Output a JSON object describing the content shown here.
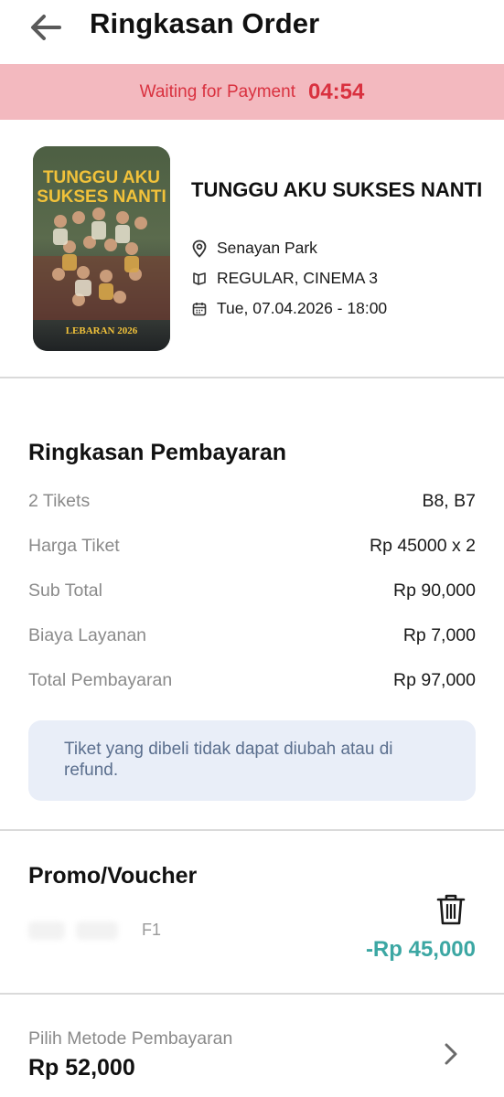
{
  "header": {
    "title": "Ringkasan Order"
  },
  "timer": {
    "label": "Waiting for Payment",
    "value": "04:54"
  },
  "movie": {
    "title": "TUNGGU AKU SUKSES NANTI",
    "poster_title_lines": [
      "TUNGGU AKU",
      "SUKSES NANTI"
    ],
    "poster_footer": "LEBARAN 2026",
    "venue": "Senayan Park",
    "studio": "REGULAR, CINEMA 3",
    "datetime": "Tue, 07.04.2026 - 18:00"
  },
  "payment_summary": {
    "title": "Ringkasan Pembayaran",
    "rows": [
      {
        "label": "2 Tikets",
        "value": "B8, B7"
      },
      {
        "label": "Harga Tiket",
        "value": "Rp 45000 x 2"
      },
      {
        "label": "Sub Total",
        "value": "Rp 90,000"
      },
      {
        "label": "Biaya Layanan",
        "value": "Rp 7,000"
      },
      {
        "label": "Total Pembayaran",
        "value": "Rp 97,000"
      }
    ],
    "notice": "Tiket yang dibeli tidak dapat diubah atau di refund."
  },
  "promo": {
    "title": "Promo/Voucher",
    "code_visible_tail": "F1",
    "discount": "-Rp 45,000"
  },
  "payment_method": {
    "label": "Pilih Metode Pembayaran",
    "total": "Rp 52,000"
  },
  "colors": {
    "timer_bg": "#f3b9bf",
    "timer_text": "#d9313f",
    "discount": "#3ca7a3",
    "notice_bg": "#e9eef8",
    "notice_text": "#5b6f8e"
  },
  "icons": [
    "back-arrow-icon",
    "location-pin-icon",
    "cinema-screen-icon",
    "calendar-icon",
    "trash-icon",
    "chevron-right-icon"
  ]
}
